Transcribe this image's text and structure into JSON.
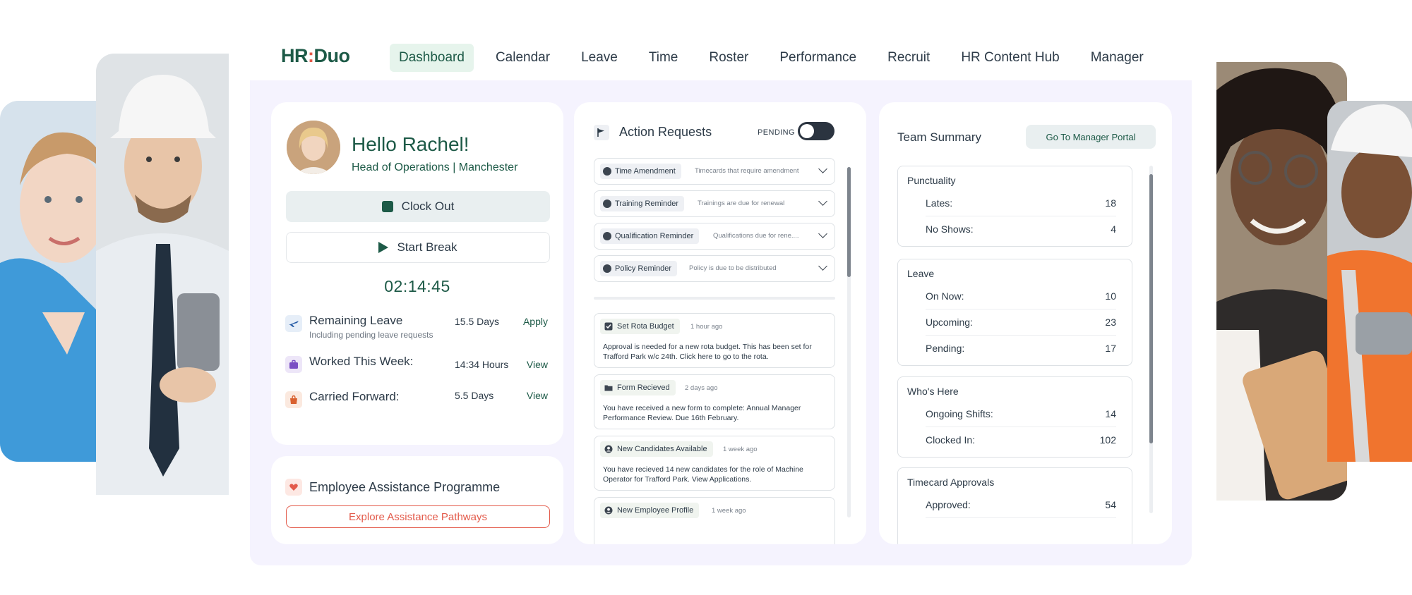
{
  "brand": {
    "logo_text_a": "HR",
    "logo_text_b": "Duo",
    "primary_color": "#1d5a47",
    "accent_color": "#e35a4a",
    "canvas_color": "#f5f3fe"
  },
  "nav": {
    "items": [
      {
        "label": "Dashboard",
        "active": true
      },
      {
        "label": "Calendar"
      },
      {
        "label": "Leave"
      },
      {
        "label": "Time"
      },
      {
        "label": "Roster"
      },
      {
        "label": "Performance"
      },
      {
        "label": "Recruit"
      },
      {
        "label": "HR Content Hub"
      },
      {
        "label": "Manager"
      }
    ]
  },
  "profile": {
    "greeting": "Hello Rachel!",
    "role": "Head of Operations | Manchester",
    "clock_out_label": "Clock Out",
    "start_break_label": "Start Break",
    "timer": "02:14:45"
  },
  "stats": [
    {
      "label": "Remaining Leave",
      "sub": "Including pending leave requests",
      "value": "15.5 Days",
      "link": "Apply",
      "icon": "airplane-icon"
    },
    {
      "label": "Worked This Week:",
      "value": "14:34 Hours",
      "link": "View",
      "icon": "briefcase-icon"
    },
    {
      "label": "Carried Forward:",
      "value": "5.5 Days",
      "link": "View",
      "icon": "bag-icon"
    }
  ],
  "eap": {
    "title": "Employee Assistance Programme",
    "button": "Explore Assistance Pathways",
    "icon": "heart-hand-icon"
  },
  "action_requests": {
    "title": "Action Requests",
    "toggle_label": "PENDING",
    "requests": [
      {
        "tag": "Time Amendment",
        "desc": "Timecards that require amendment"
      },
      {
        "tag": "Training Reminder",
        "desc": "Trainings are due for renewal"
      },
      {
        "tag": "Qualification Reminder",
        "desc": "Qualifications due for rene...."
      },
      {
        "tag": "Policy Reminder",
        "desc": "Policy is due to be distributed"
      }
    ],
    "notifications": [
      {
        "tag": "Set Rota Budget",
        "ago": "1 hour ago",
        "icon": "checkbox-icon",
        "body": "Approval is needed for a new rota budget. This has been set for Trafford Park w/c 24th. Click here to go to the rota."
      },
      {
        "tag": "Form Recieved",
        "ago": "2 days ago",
        "icon": "folder-icon",
        "body": "You have received a new form to complete: Annual Manager Performance Review. Due 16th February."
      },
      {
        "tag": "New Candidates Available",
        "ago": "1 week ago",
        "icon": "user-icon",
        "body": "You have recieved 14 new candidates for the role of Machine Operator for Trafford Park. View Applications."
      },
      {
        "tag": "New Employee Profile",
        "ago": "1 week ago",
        "icon": "user-icon",
        "body": ""
      }
    ]
  },
  "team_summary": {
    "title": "Team Summary",
    "button": "Go To Manager Portal",
    "groups": [
      {
        "title": "Punctuality",
        "rows": [
          {
            "label": "Lates:",
            "value": "18"
          },
          {
            "label": "No Shows:",
            "value": "4"
          }
        ]
      },
      {
        "title": "Leave",
        "rows": [
          {
            "label": "On Now:",
            "value": "10"
          },
          {
            "label": "Upcoming:",
            "value": "23"
          },
          {
            "label": "Pending:",
            "value": "17"
          }
        ]
      },
      {
        "title": "Who's Here",
        "rows": [
          {
            "label": "Ongoing Shifts:",
            "value": "14"
          },
          {
            "label": "Clocked In:",
            "value": "102"
          }
        ]
      },
      {
        "title": "Timecard Approvals",
        "rows": [
          {
            "label": "Approved:",
            "value": "54"
          }
        ]
      }
    ]
  }
}
